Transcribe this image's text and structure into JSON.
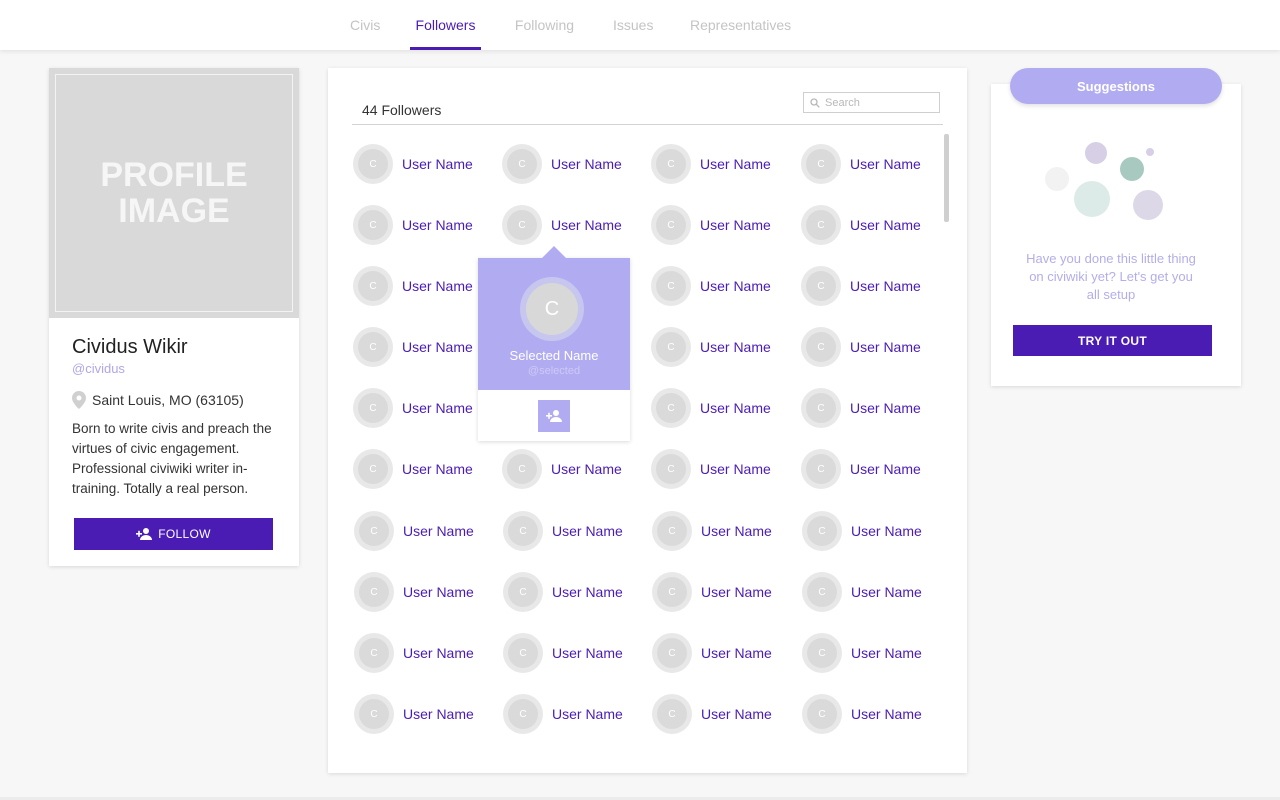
{
  "nav": {
    "tabs": [
      {
        "label": "Civis",
        "active": false
      },
      {
        "label": "Followers",
        "active": true
      },
      {
        "label": "Following",
        "active": false
      },
      {
        "label": "Issues",
        "active": false
      },
      {
        "label": "Representatives",
        "active": false
      }
    ]
  },
  "profile": {
    "image_placeholder": "PROFILE\nIMAGE",
    "name": "Cividus Wikir",
    "handle": "@cividus",
    "location": "Saint Louis, MO (63105)",
    "bio": "Born to write civis and preach the virtues of civic engagement. Professional civiwiki writer in-training. Totally a real person.",
    "follow_label": "FOLLOW",
    "location_icon": "map-pin-icon",
    "follow_icon": "add-person-icon"
  },
  "followers": {
    "count_label": "44 Followers",
    "search_placeholder": "Search",
    "avatar_initial": "C",
    "user_label": "User Name",
    "rows": 10,
    "columns": 4
  },
  "popover": {
    "avatar_initial": "C",
    "name": "Selected Name",
    "handle": "@selected",
    "add_icon": "add-person-icon"
  },
  "suggestions": {
    "title": "Suggestions",
    "text": "Have you done this little thing on civiwiki yet? Let's get you all setup",
    "button_label": "TRY IT OUT"
  },
  "colors": {
    "accent": "#4a1cb4",
    "accent_light": "#b1acf2",
    "muted_text": "#b3aeea"
  }
}
